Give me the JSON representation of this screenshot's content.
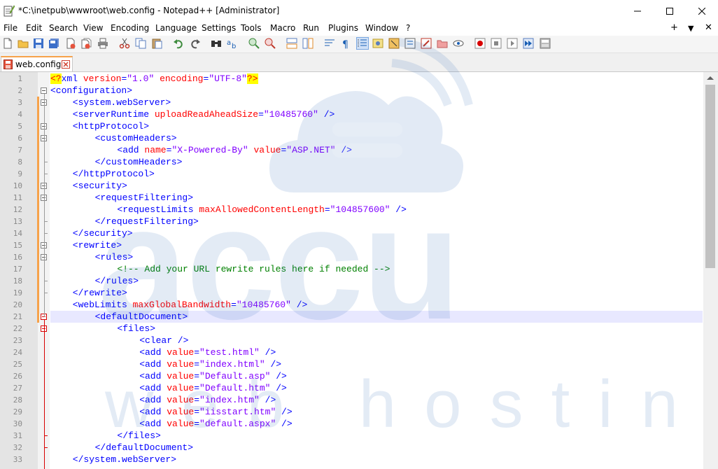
{
  "window": {
    "title": "*C:\\inetpub\\wwwroot\\web.config - Notepad++ [Administrator]"
  },
  "menu": {
    "items": [
      "File",
      "Edit",
      "Search",
      "View",
      "Encoding",
      "Language",
      "Settings",
      "Tools",
      "Macro",
      "Run",
      "Plugins",
      "Window",
      "?"
    ],
    "right": [
      "+",
      "▼",
      "✕"
    ]
  },
  "tab": {
    "label": "web.config"
  },
  "watermark": {
    "brand": "accu",
    "sub": "web hosting"
  },
  "colors": {
    "tag": "#0000ff",
    "attribute": "#ff0000",
    "value": "#8000ff",
    "comment": "#008000",
    "change_marker": "#f7a24a",
    "fold_active": "#d80000"
  },
  "lines": [
    {
      "n": "1",
      "indent": 0,
      "seg": [
        [
          "pi",
          "<?"
        ],
        [
          "tag",
          "xml "
        ],
        [
          "attr",
          "version"
        ],
        [
          "tag",
          "="
        ],
        [
          "val",
          "\"1.0\""
        ],
        [
          "tag",
          " "
        ],
        [
          "attr",
          "encoding"
        ],
        [
          "tag",
          "="
        ],
        [
          "val",
          "\"UTF-8\""
        ],
        [
          "pi",
          "?>"
        ]
      ]
    },
    {
      "n": "2",
      "indent": 0,
      "seg": [
        [
          "tag",
          "<configuration>"
        ]
      ]
    },
    {
      "n": "3",
      "indent": 4,
      "seg": [
        [
          "tag",
          "<system.webServer>"
        ]
      ]
    },
    {
      "n": "4",
      "indent": 4,
      "seg": [
        [
          "tag",
          "<serverRuntime "
        ],
        [
          "attr",
          "uploadReadAheadSize"
        ],
        [
          "tag",
          "="
        ],
        [
          "val",
          "\"10485760\""
        ],
        [
          "tag",
          " />"
        ]
      ]
    },
    {
      "n": "5",
      "indent": 4,
      "seg": [
        [
          "tag",
          "<httpProtocol>"
        ]
      ]
    },
    {
      "n": "6",
      "indent": 8,
      "seg": [
        [
          "tag",
          "<customHeaders>"
        ]
      ]
    },
    {
      "n": "7",
      "indent": 12,
      "seg": [
        [
          "tag",
          "<add "
        ],
        [
          "attr",
          "name"
        ],
        [
          "tag",
          "="
        ],
        [
          "val",
          "\"X-Powered-By\""
        ],
        [
          "tag",
          " "
        ],
        [
          "attr",
          "value"
        ],
        [
          "tag",
          "="
        ],
        [
          "val",
          "\"ASP.NET\""
        ],
        [
          "tag",
          " />"
        ]
      ]
    },
    {
      "n": "8",
      "indent": 8,
      "seg": [
        [
          "tag",
          "</customHeaders>"
        ]
      ]
    },
    {
      "n": "9",
      "indent": 4,
      "seg": [
        [
          "tag",
          "</httpProtocol>"
        ]
      ]
    },
    {
      "n": "10",
      "indent": 4,
      "seg": [
        [
          "tag",
          "<security>"
        ]
      ]
    },
    {
      "n": "11",
      "indent": 8,
      "seg": [
        [
          "tag",
          "<requestFiltering>"
        ]
      ]
    },
    {
      "n": "12",
      "indent": 12,
      "seg": [
        [
          "tag",
          "<requestLimits "
        ],
        [
          "attr",
          "maxAllowedContentLength"
        ],
        [
          "tag",
          "="
        ],
        [
          "val",
          "\"104857600\""
        ],
        [
          "tag",
          " />"
        ]
      ]
    },
    {
      "n": "13",
      "indent": 8,
      "seg": [
        [
          "tag",
          "</requestFiltering>"
        ]
      ]
    },
    {
      "n": "14",
      "indent": 4,
      "seg": [
        [
          "tag",
          "</security>"
        ]
      ]
    },
    {
      "n": "15",
      "indent": 4,
      "seg": [
        [
          "tag",
          "<rewrite>"
        ]
      ]
    },
    {
      "n": "16",
      "indent": 8,
      "seg": [
        [
          "tag",
          "<rules>"
        ]
      ]
    },
    {
      "n": "17",
      "indent": 12,
      "seg": [
        [
          "cmt",
          "<!-- Add your URL rewrite rules here if needed -->"
        ]
      ]
    },
    {
      "n": "18",
      "indent": 8,
      "seg": [
        [
          "tag",
          "</rules>"
        ]
      ]
    },
    {
      "n": "19",
      "indent": 4,
      "seg": [
        [
          "tag",
          "</rewrite>"
        ]
      ]
    },
    {
      "n": "20",
      "indent": 4,
      "seg": [
        [
          "tag",
          "<webLimits "
        ],
        [
          "attr",
          "maxGlobalBandwidth"
        ],
        [
          "tag",
          "="
        ],
        [
          "val",
          "\"10485760\""
        ],
        [
          "tag",
          " />"
        ]
      ]
    },
    {
      "n": "21",
      "indent": 8,
      "seg": [
        [
          "tag",
          "<defaultDocument>"
        ]
      ]
    },
    {
      "n": "22",
      "indent": 12,
      "seg": [
        [
          "tag",
          "<files>"
        ]
      ]
    },
    {
      "n": "23",
      "indent": 16,
      "seg": [
        [
          "tag",
          "<clear />"
        ]
      ]
    },
    {
      "n": "24",
      "indent": 16,
      "seg": [
        [
          "tag",
          "<add "
        ],
        [
          "attr",
          "value"
        ],
        [
          "tag",
          "="
        ],
        [
          "val",
          "\"test.html\""
        ],
        [
          "tag",
          " />"
        ]
      ]
    },
    {
      "n": "25",
      "indent": 16,
      "seg": [
        [
          "tag",
          "<add "
        ],
        [
          "attr",
          "value"
        ],
        [
          "tag",
          "="
        ],
        [
          "val",
          "\"index.html\""
        ],
        [
          "tag",
          " />"
        ]
      ]
    },
    {
      "n": "26",
      "indent": 16,
      "seg": [
        [
          "tag",
          "<add "
        ],
        [
          "attr",
          "value"
        ],
        [
          "tag",
          "="
        ],
        [
          "val",
          "\"Default.asp\""
        ],
        [
          "tag",
          " />"
        ]
      ]
    },
    {
      "n": "27",
      "indent": 16,
      "seg": [
        [
          "tag",
          "<add "
        ],
        [
          "attr",
          "value"
        ],
        [
          "tag",
          "="
        ],
        [
          "val",
          "\"Default.htm\""
        ],
        [
          "tag",
          " />"
        ]
      ]
    },
    {
      "n": "28",
      "indent": 16,
      "seg": [
        [
          "tag",
          "<add "
        ],
        [
          "attr",
          "value"
        ],
        [
          "tag",
          "="
        ],
        [
          "val",
          "\"index.htm\""
        ],
        [
          "tag",
          " />"
        ]
      ]
    },
    {
      "n": "29",
      "indent": 16,
      "seg": [
        [
          "tag",
          "<add "
        ],
        [
          "attr",
          "value"
        ],
        [
          "tag",
          "="
        ],
        [
          "val",
          "\"iisstart.htm\""
        ],
        [
          "tag",
          " />"
        ]
      ]
    },
    {
      "n": "30",
      "indent": 16,
      "seg": [
        [
          "tag",
          "<add "
        ],
        [
          "attr",
          "value"
        ],
        [
          "tag",
          "="
        ],
        [
          "val",
          "\"default.aspx\""
        ],
        [
          "tag",
          " />"
        ]
      ]
    },
    {
      "n": "31",
      "indent": 12,
      "seg": [
        [
          "tag",
          "</files>"
        ]
      ]
    },
    {
      "n": "32",
      "indent": 8,
      "seg": [
        [
          "tag",
          "</defaultDocument>"
        ]
      ]
    },
    {
      "n": "33",
      "indent": 4,
      "seg": [
        [
          "tag",
          "</system.webServer>"
        ]
      ]
    }
  ]
}
